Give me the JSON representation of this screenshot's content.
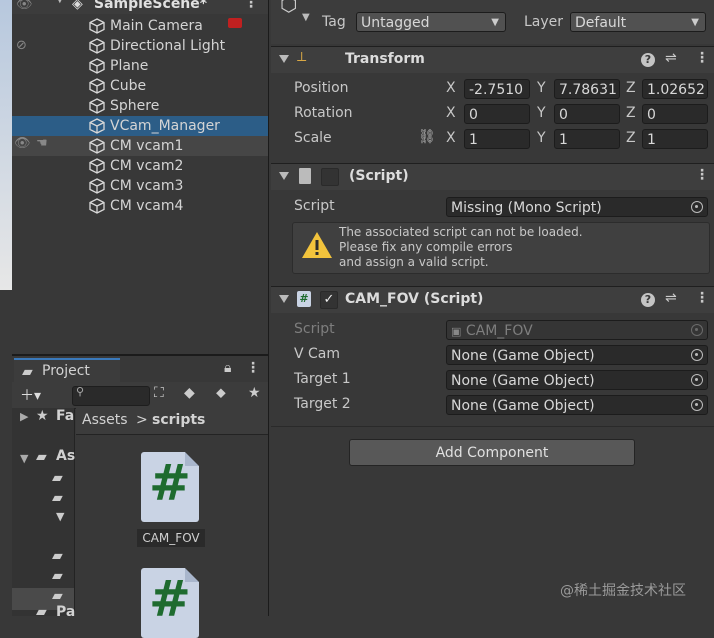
{
  "hierarchy": {
    "scene": "SampleScene*",
    "items": [
      {
        "label": "Main Camera"
      },
      {
        "label": "Directional Light"
      },
      {
        "label": "Plane"
      },
      {
        "label": "Cube"
      },
      {
        "label": "Sphere"
      },
      {
        "label": "VCam_Manager",
        "selected": true
      },
      {
        "label": "CM vcam1"
      },
      {
        "label": "CM vcam2"
      },
      {
        "label": "CM vcam3"
      },
      {
        "label": "CM vcam4"
      }
    ]
  },
  "project": {
    "tab": "Project",
    "tree": [
      "Fa",
      "As",
      "Pa"
    ],
    "breadcrumb": {
      "root": "Assets",
      "sep": ">",
      "current": "scripts"
    },
    "file_label": "CAM_FOV"
  },
  "inspector": {
    "tag_label": "Tag",
    "tag_value": "Untagged",
    "layer_label": "Layer",
    "layer_value": "Default",
    "transform": {
      "title": "Transform",
      "position_label": "Position",
      "pos_x": "-2.7510",
      "pos_y": "7.78631",
      "pos_z": "1.02652",
      "rotation_label": "Rotation",
      "rot_x": "0",
      "rot_y": "0",
      "rot_z": "0",
      "scale_label": "Scale",
      "scale_x": "1",
      "scale_y": "1",
      "scale_z": "1",
      "axis_x": "X",
      "axis_y": "Y",
      "axis_z": "Z"
    },
    "missing": {
      "title": "(Script)",
      "script_label": "Script",
      "script_value": "Missing (Mono Script)",
      "warning_line1": "The associated script can not be loaded.",
      "warning_line2": "Please fix any compile errors",
      "warning_line3": "and assign a valid script."
    },
    "camfov": {
      "title": "CAM_FOV (Script)",
      "script_label": "Script",
      "script_value": "CAM_FOV",
      "vcam_label": "V Cam",
      "vcam_value": "None (Game Object)",
      "t1_label": "Target 1",
      "t1_value": "None (Game Object)",
      "t2_label": "Target 2",
      "t2_value": "None (Game Object)"
    },
    "add_component": "Add Component"
  },
  "watermark": "@稀土掘金技术社区"
}
